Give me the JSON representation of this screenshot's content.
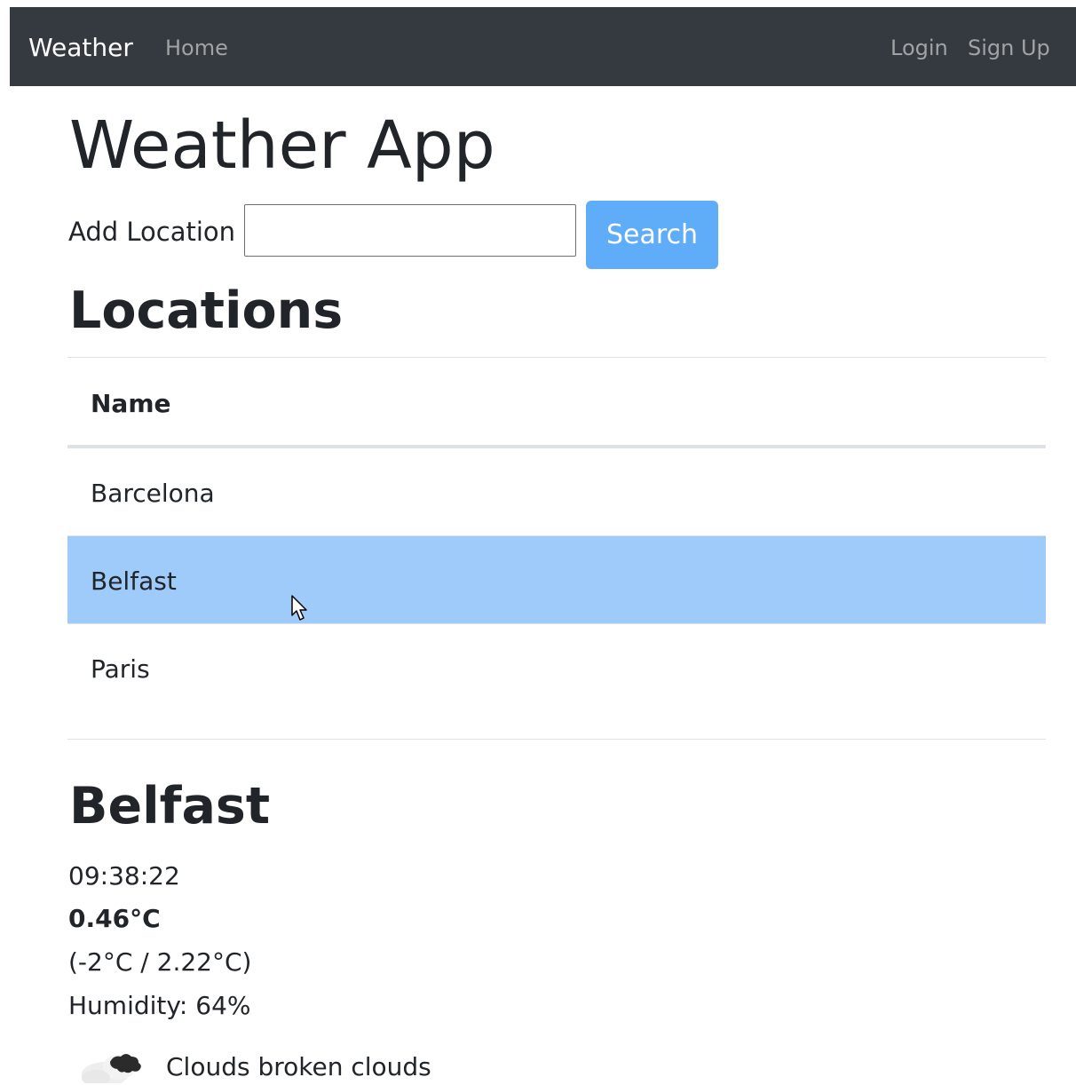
{
  "navbar": {
    "brand": "Weather",
    "links": {
      "home": "Home",
      "login": "Login",
      "signup": "Sign Up"
    }
  },
  "header": {
    "title": "Weather App"
  },
  "add_location": {
    "label": "Add Location",
    "value": "",
    "placeholder": "",
    "button_label": "Search"
  },
  "locations": {
    "title": "Locations",
    "columns": [
      "Name"
    ],
    "rows": [
      {
        "name": "Barcelona",
        "selected": false
      },
      {
        "name": "Belfast",
        "selected": true
      },
      {
        "name": "Paris",
        "selected": false
      }
    ]
  },
  "detail": {
    "city": "Belfast",
    "time": "09:38:22",
    "temperature": "0.46°C",
    "range": "(-2°C / 2.22°C)",
    "humidity": "Humidity: 64%",
    "icon": "broken-clouds-icon",
    "description": "Clouds broken clouds"
  },
  "colors": {
    "navbar_bg": "#343a40",
    "primary_button": "#5fadf9",
    "selected_row": "#9ecbfa"
  }
}
